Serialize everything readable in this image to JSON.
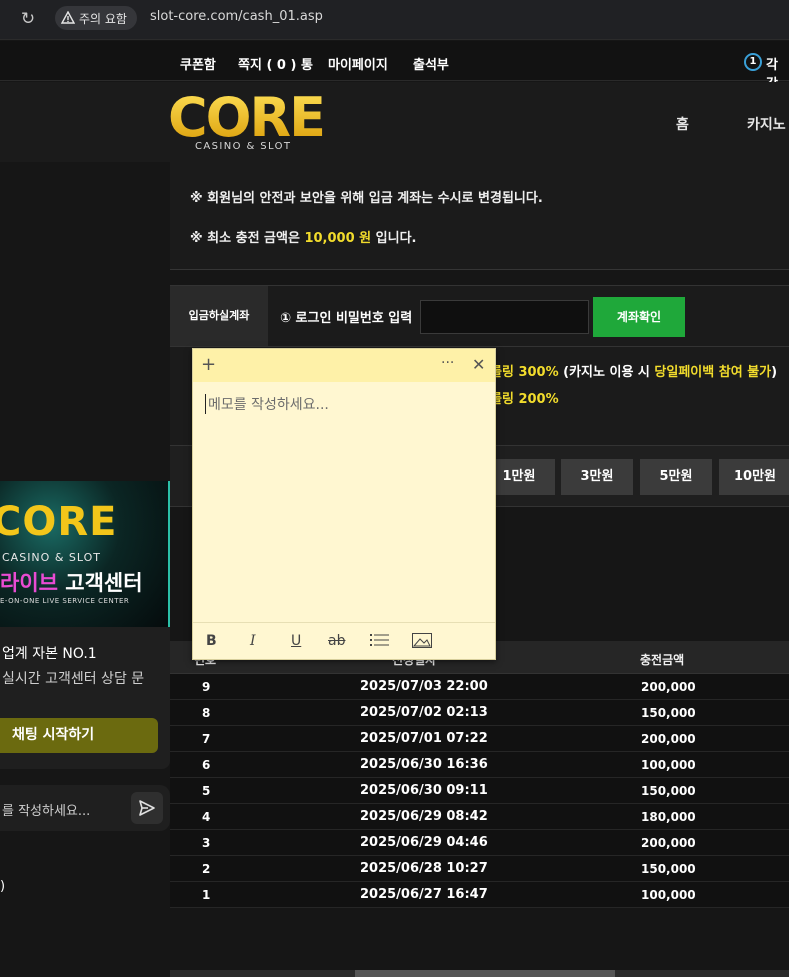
{
  "browser": {
    "warning_label": "주의 요함",
    "url": "slot-core.com/cash_01.asp"
  },
  "topnav": {
    "items": [
      "쿠폰함",
      "쪽지 ( 0 ) 통",
      "마이페이지",
      "출석부"
    ],
    "badge_number": "1",
    "badge_text": "각각"
  },
  "header": {
    "logo_text": "CORE",
    "logo_sub": "CASINO & SLOT",
    "nav_home": "홈",
    "nav_casino": "카지노"
  },
  "notice": {
    "line1": "※ 회원님의 안전과 보안을 위해 입금 계좌는 수시로 변경됩니다.",
    "line2_prefix": "※ 최소 충전 금액은 ",
    "line2_amount": "10,000 원",
    "line2_suffix": " 입니다."
  },
  "account": {
    "label": "입금하실계좌",
    "prompt": "① 로그인 비밀번호 입력",
    "input_value": "",
    "button": "계좌확인"
  },
  "bonus": {
    "line1_a": "롤링 300%",
    "line1_b": " (카지노 이용 시 ",
    "line1_c": "당일페이백 참여 불가",
    "line1_d": ")",
    "line2": "롤링 200%"
  },
  "amounts": [
    "1만원",
    "3만원",
    "5만원",
    "10만원"
  ],
  "table": {
    "headers": [
      "번호",
      "신청일자",
      "충전금액"
    ],
    "rows": [
      {
        "no": "9",
        "date": "2025/07/03 22:00",
        "amount": "200,000"
      },
      {
        "no": "8",
        "date": "2025/07/02 02:13",
        "amount": "150,000"
      },
      {
        "no": "7",
        "date": "2025/07/01 07:22",
        "amount": "200,000"
      },
      {
        "no": "6",
        "date": "2025/06/30 16:36",
        "amount": "100,000"
      },
      {
        "no": "5",
        "date": "2025/06/30 09:11",
        "amount": "150,000"
      },
      {
        "no": "4",
        "date": "2025/06/29 08:42",
        "amount": "180,000"
      },
      {
        "no": "3",
        "date": "2025/06/29 04:46",
        "amount": "200,000"
      },
      {
        "no": "2",
        "date": "2025/06/28 10:27",
        "amount": "150,000"
      },
      {
        "no": "1",
        "date": "2025/06/27 16:47",
        "amount": "100,000"
      }
    ]
  },
  "promo": {
    "logo": "CORE",
    "sub": "CASINO & SLOT",
    "title_pink": "라이브",
    "title_white": " 고객센터",
    "tiny": "E-ON-ONE LIVE SERVICE CENTER"
  },
  "chat": {
    "line1": "업계 자본 NO.1",
    "line2": "실시간 고객센터 상담 문",
    "button": "채팅 시작하기",
    "input_placeholder": "를 작성하세요..."
  },
  "left_glyph": ")",
  "note": {
    "placeholder": "메모를 작성하세요...",
    "more": "···"
  },
  "colors": {
    "accent_yellow": "#f2dc2c",
    "confirm_green": "#1fa83a",
    "note_bg": "#fff7d1"
  }
}
